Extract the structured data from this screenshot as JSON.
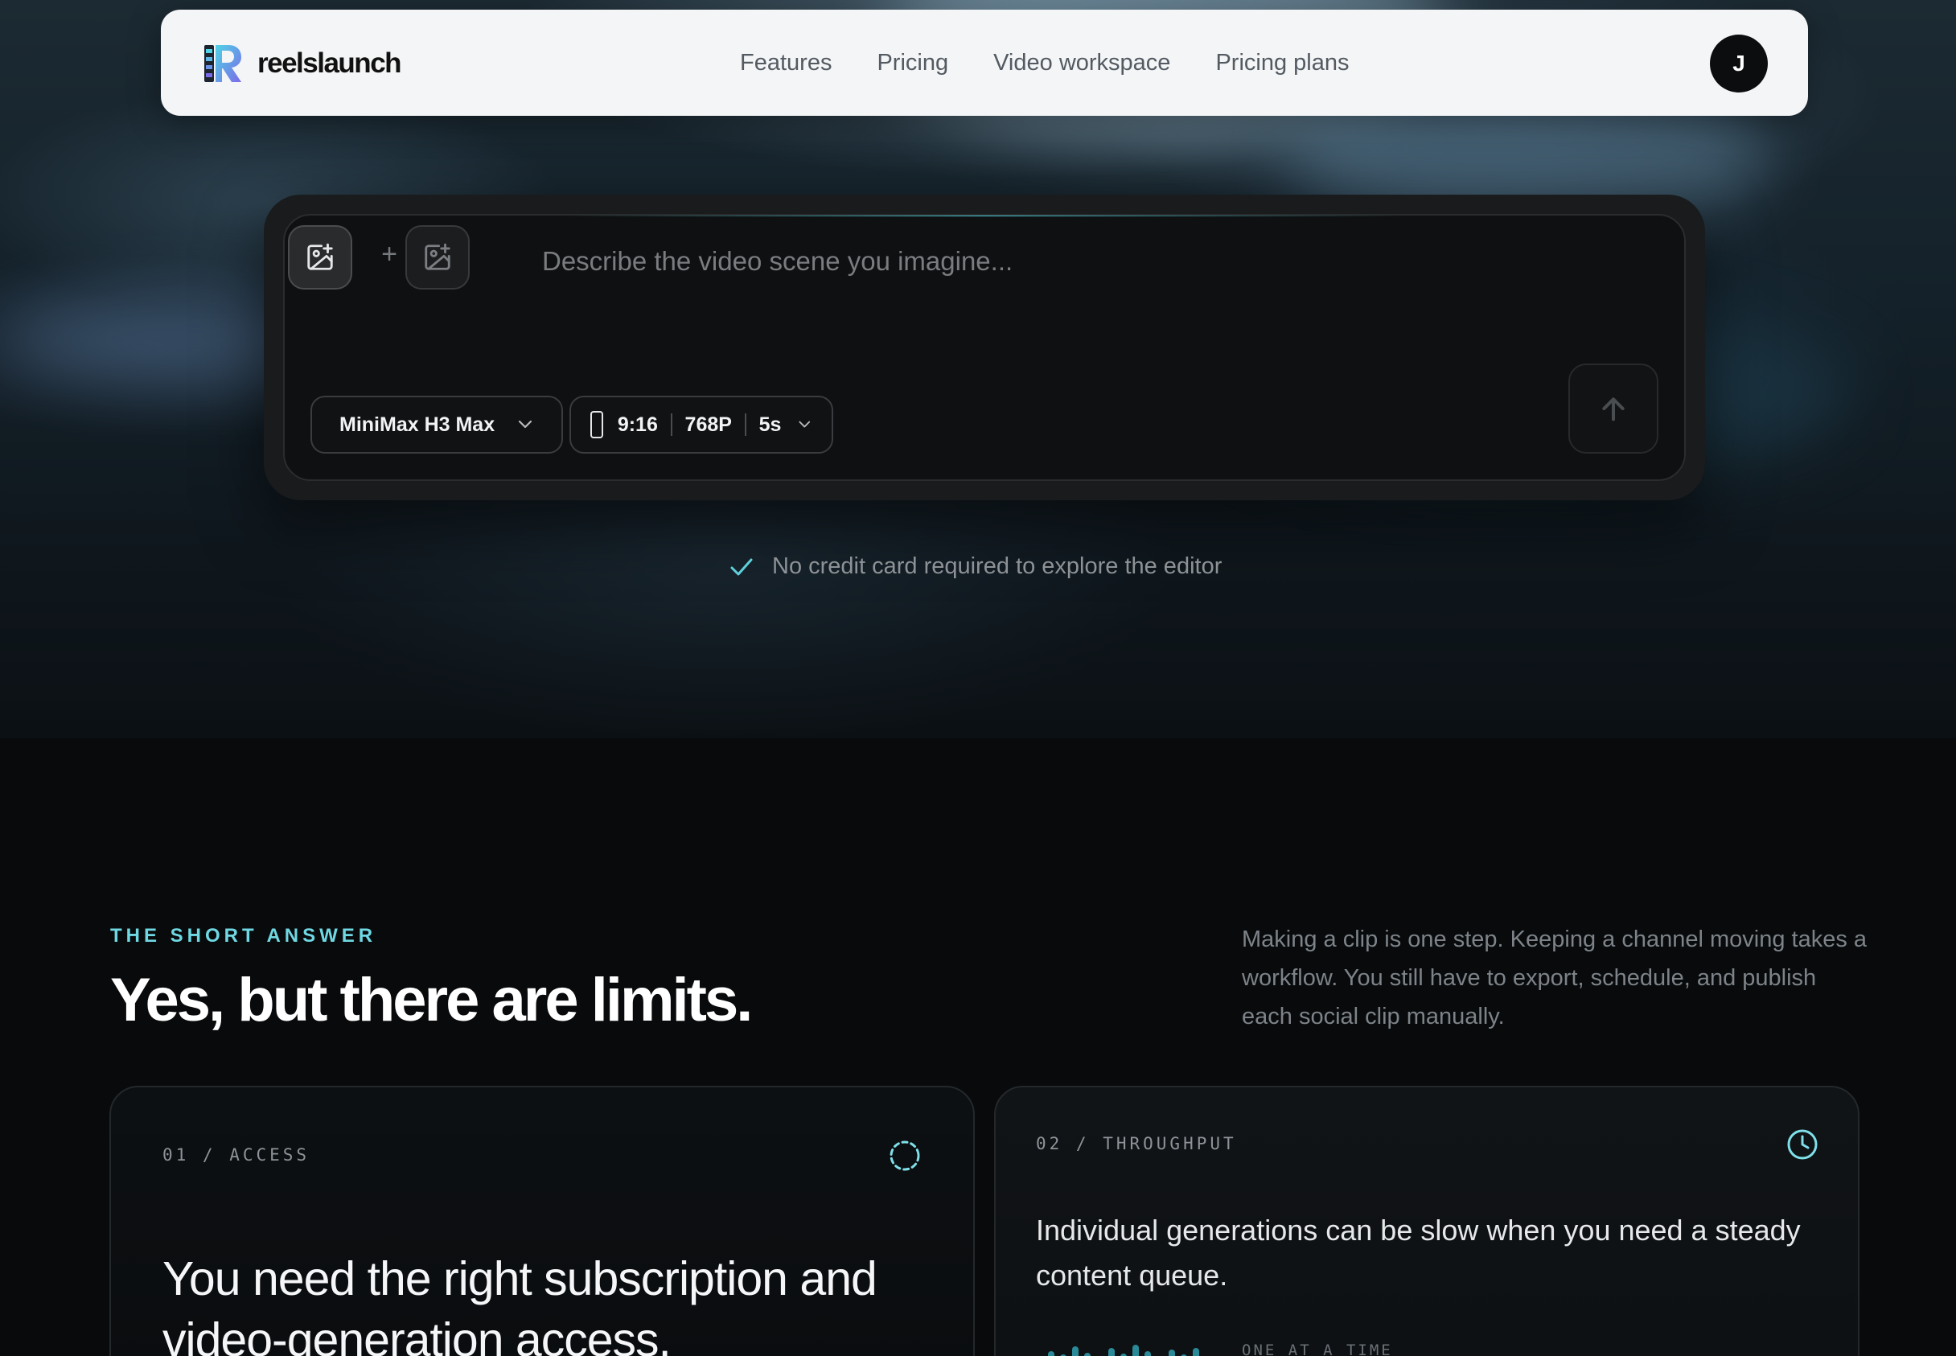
{
  "brand": {
    "name": "reelslaunch"
  },
  "nav": {
    "links": [
      "Features",
      "Pricing",
      "Video workspace",
      "Pricing plans"
    ],
    "avatar_initial": "J"
  },
  "prompt": {
    "placeholder": "Describe the video scene you imagine...",
    "add_separator": "+",
    "model": "MiniMax H3 Max",
    "aspect_ratio": "9:16",
    "resolution": "768P",
    "duration": "5s"
  },
  "note": "No credit card required to explore the editor",
  "section": {
    "eyebrow": "THE SHORT ANSWER",
    "headline": "Yes, but there are limits.",
    "side_copy": "Making a clip is one step. Keeping a channel moving takes a workflow. You still have to export, schedule, and publish each social clip manually."
  },
  "cards": [
    {
      "label": "01 / ACCESS",
      "icon": "dashed-circle-icon",
      "title": "You need the right subscription and video-generation access."
    },
    {
      "label": "02 / THROUGHPUT",
      "icon": "clock-icon",
      "title": "Individual generations can be slow when you need a steady content queue.",
      "caption": "ONE AT A TIME"
    }
  ],
  "colors": {
    "accent": "#6fd8e3",
    "page_bg": "#080a0c",
    "nav_bg": "#f3f5f6"
  }
}
